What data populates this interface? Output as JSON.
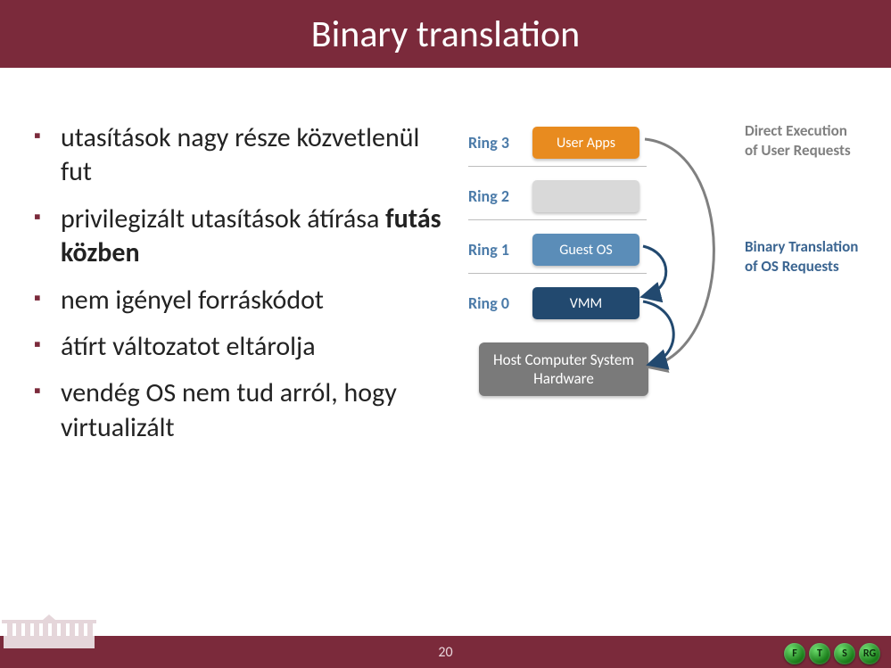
{
  "title": "Binary translation",
  "bullets": [
    {
      "text": "utasítások nagy része közvetlenül fut",
      "bold": ""
    },
    {
      "text": "privilegizált utasítások átírása ",
      "bold": "futás közben"
    },
    {
      "text": "nem igényel forráskódot",
      "bold": ""
    },
    {
      "text": "átírt változatot eltárolja",
      "bold": ""
    },
    {
      "text": "vendég OS nem tud arról, hogy virtualizált",
      "bold": ""
    }
  ],
  "diagram": {
    "rings": {
      "r3": {
        "label": "Ring 3",
        "box": "User Apps"
      },
      "r2": {
        "label": "Ring 2",
        "box": ""
      },
      "r1": {
        "label": "Ring 1",
        "box": "Guest OS"
      },
      "r0": {
        "label": "Ring 0",
        "box": "VMM"
      }
    },
    "host": "Host Computer System Hardware",
    "label_direct": "Direct Execution of User Requests",
    "label_binary": "Binary Translation of OS Requests"
  },
  "footer": {
    "page": "20",
    "logos": [
      "F",
      "T",
      "S",
      "RG"
    ]
  }
}
